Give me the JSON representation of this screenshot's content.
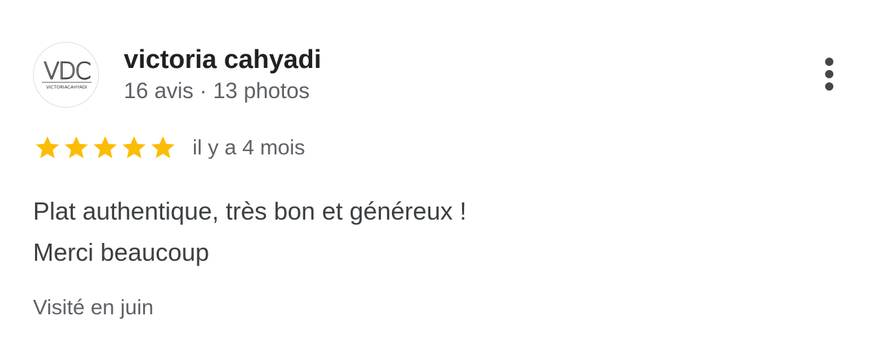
{
  "reviewer": {
    "name": "victoria cahyadi",
    "meta": "16 avis · 13 photos",
    "avatar": {
      "monogram": "VDC",
      "caption": "VICTORIACAHYADI"
    }
  },
  "review": {
    "rating": 5,
    "rating_max": 5,
    "star_color": "#fbbc04",
    "date": "il y a 4 mois",
    "text_lines": [
      "Plat authentique, très bon et généreux !",
      "Merci beaucoup"
    ],
    "visit": "Visité en juin"
  },
  "actions": {
    "more_icon": "more-vertical-icon"
  }
}
